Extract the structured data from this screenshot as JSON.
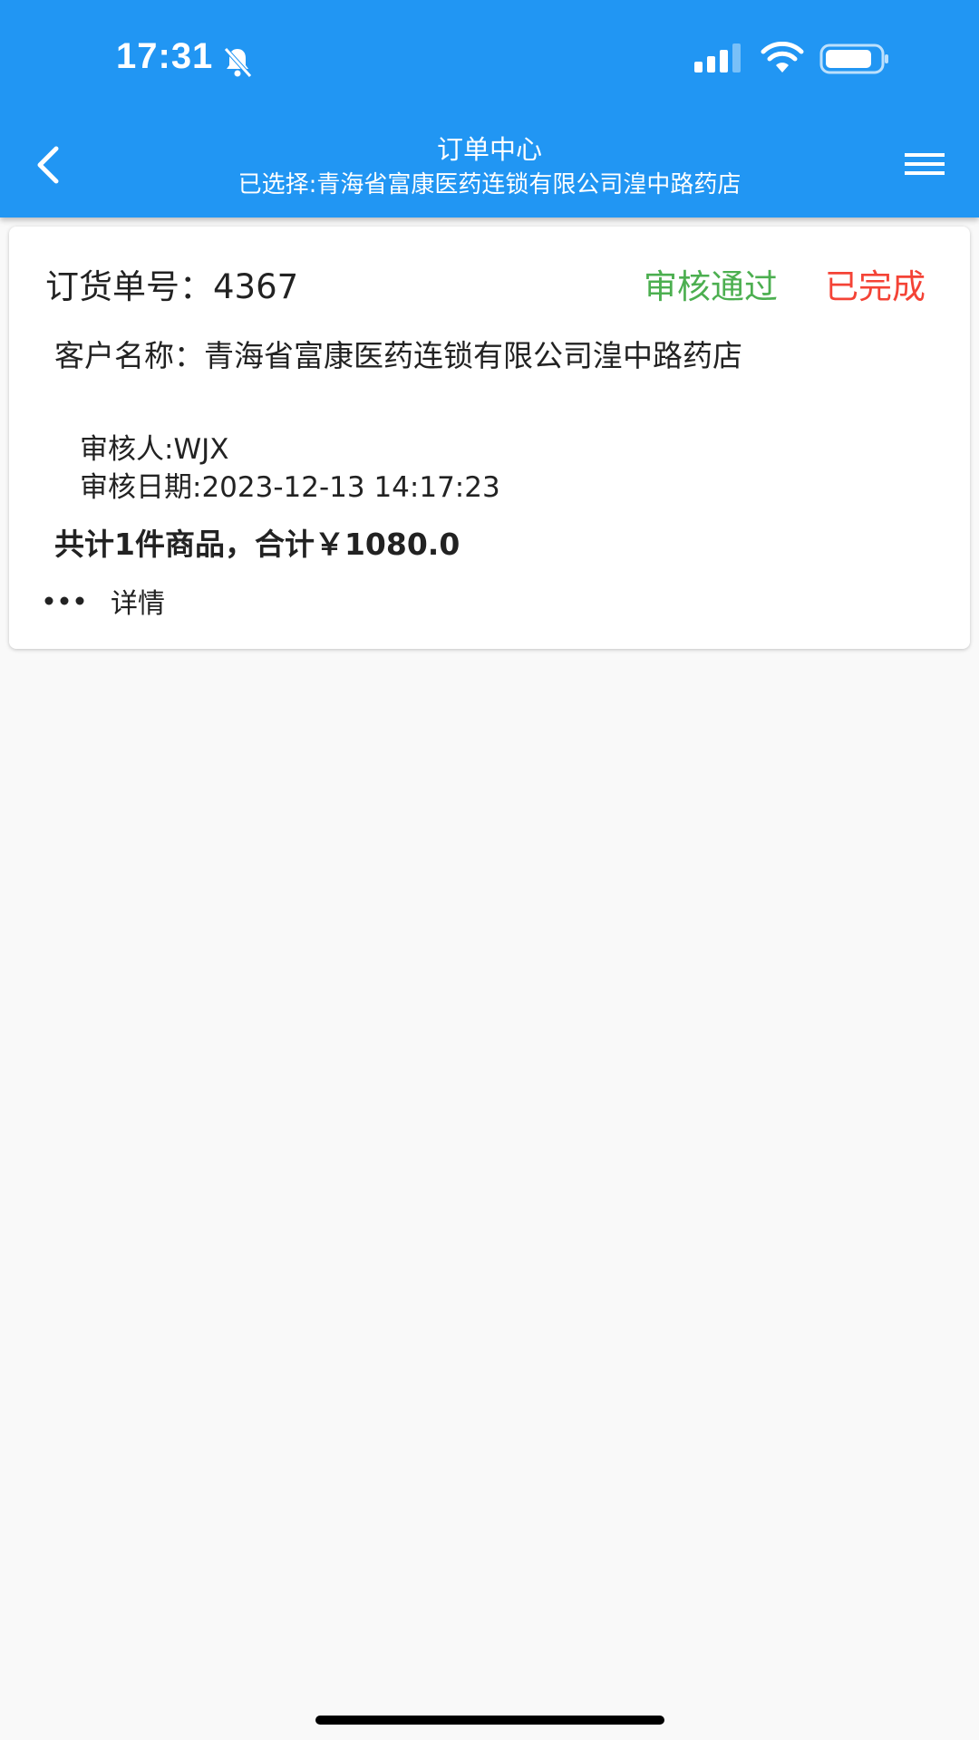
{
  "status_bar": {
    "time": "17:31",
    "icons": [
      "bell-slash-icon",
      "signal-icon",
      "wifi-icon",
      "battery-icon"
    ]
  },
  "header": {
    "title": "订单中心",
    "subtitle": "已选择:青海省富康医药连锁有限公司湟中路药店",
    "back_icon": "chevron-left-icon",
    "menu_icon": "hamburger-menu-icon"
  },
  "orders": [
    {
      "order_label": "订货单号：",
      "order_number": "4367",
      "audit_status": "审核通过",
      "order_status": "已完成",
      "customer_label": "客户名称：",
      "customer_name": "青海省富康医药连锁有限公司湟中路药店",
      "reviewer": "审核人:WJX",
      "review_date": "审核日期:2023-12-13 14:17:23",
      "summary": "共计1件商品，合计￥1080.0",
      "details_label": "详情"
    }
  ],
  "colors": {
    "header_bg": "#2196f3",
    "approved": "#4caf50",
    "completed": "#f44336",
    "page_bg": "#f9f9f9"
  }
}
